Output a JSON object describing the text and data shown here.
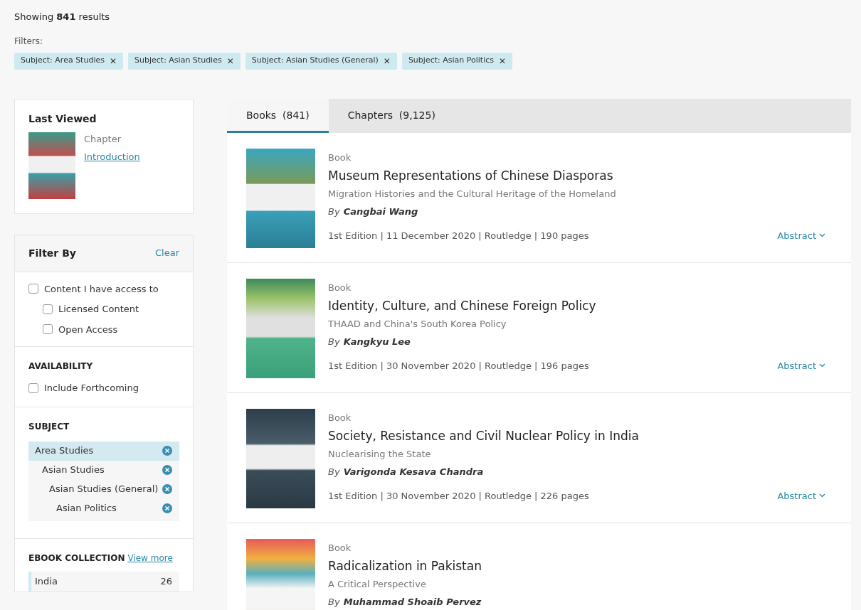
{
  "results": {
    "text": "Showing **841** results"
  },
  "filters": {
    "label": "Filters:",
    "chips": [
      {
        "label": "Subject: Area Studies",
        "remove": "✕"
      },
      {
        "label": "Subject: Asian Studies",
        "remove": "✕"
      },
      {
        "label": "Subject: Asian Studies (General)",
        "remove": "✕"
      },
      {
        "label": "Subject: Asian Politics",
        "remove": "✕"
      }
    ]
  },
  "last_viewed": {
    "title": "Last Viewed",
    "type": "Chapter",
    "link": "Introduction"
  },
  "filter_by": {
    "title": "Filter By",
    "clear": "Clear",
    "access": [
      {
        "label": "Content I have access to",
        "checked": false,
        "children": [
          {
            "label": "Licensed Content",
            "checked": false
          },
          {
            "label": "Open Access",
            "checked": false
          }
        ]
      }
    ],
    "availability": {
      "title": "AVAILABILITY",
      "options": [
        {
          "label": "Include Forthcoming",
          "checked": false
        }
      ]
    },
    "subject": {
      "title": "SUBJECT",
      "items": [
        {
          "label": "Area Studies",
          "selected": true,
          "children": [
            {
              "label": "Asian Studies",
              "selected": false,
              "children": [
                {
                  "label": "Asian Studies (General)",
                  "selected": false,
                  "children": [
                    {
                      "label": "Asian Politics",
                      "selected": false
                    }
                  ]
                }
              ]
            }
          ]
        }
      ]
    },
    "ebook_collection": {
      "title": "EBOOK COLLECTION",
      "link": "View more",
      "items": [
        {
          "label": "India",
          "count": "26"
        }
      ]
    }
  },
  "tabs": [
    {
      "label": "Books  (841)",
      "selected": true
    },
    {
      "label": "Chapters  (9,125)",
      "selected": false
    }
  ],
  "books": [
    {
      "type": "Book",
      "title": "Museum Representations of Chinese Diasporas",
      "subtitle": "Migration Histories and the Cultural Heritage of the Homeland",
      "by": "By",
      "author": "Cangbai Wang",
      "meta": "1st Edition | 11 December 2020 | Routledge | 190 pages",
      "abstract": "Abstract"
    },
    {
      "type": "Book",
      "title": "Identity, Culture, and Chinese Foreign Policy",
      "subtitle": "THAAD and China's South Korea Policy",
      "by": "By",
      "author": "Kangkyu Lee",
      "meta": "1st Edition | 30 November 2020 | Routledge | 196 pages",
      "abstract": "Abstract"
    },
    {
      "type": "Book",
      "title": "Society, Resistance and Civil Nuclear Policy in India",
      "subtitle": "Nuclearising the State",
      "by": "By",
      "author": "Varigonda Kesava Chandra",
      "meta": "1st Edition | 30 November 2020 | Routledge | 226 pages",
      "abstract": "Abstract"
    },
    {
      "type": "Book",
      "title": "Radicalization in Pakistan",
      "subtitle": "A Critical Perspective",
      "by": "By",
      "author": "Muhammad Shoaib Pervez"
    }
  ]
}
